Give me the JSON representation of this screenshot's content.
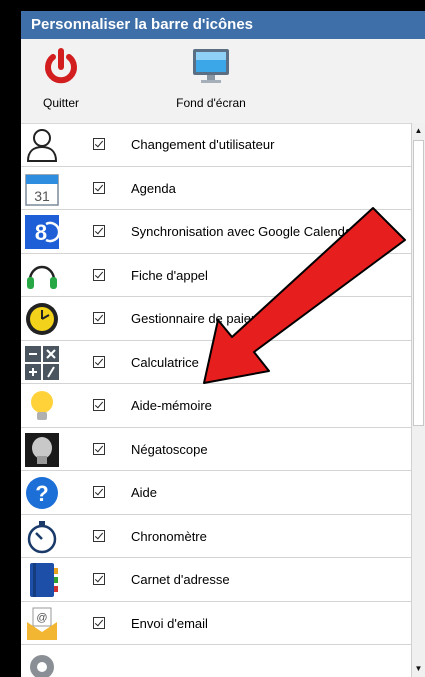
{
  "window": {
    "title": "Personnaliser la barre d'icônes"
  },
  "toolbar": {
    "quit_label": "Quitter",
    "wallpaper_label": "Fond d'écran",
    "quit_icon": "power-icon",
    "wallpaper_icon": "monitor-icon"
  },
  "items": [
    {
      "label": "Changement d'utilisateur",
      "icon": "user-icon",
      "checked": true
    },
    {
      "label": "Agenda",
      "icon": "calendar-icon",
      "checked": true
    },
    {
      "label": "Synchronisation avec Google Calendar",
      "icon": "sync-icon",
      "checked": true
    },
    {
      "label": "Fiche d'appel",
      "icon": "headset-icon",
      "checked": true
    },
    {
      "label": "Gestionnaire de paiements",
      "icon": "clock-icon",
      "checked": true
    },
    {
      "label": "Calculatrice",
      "icon": "calculator-icon",
      "checked": true
    },
    {
      "label": "Aide-mémoire",
      "icon": "lightbulb-icon",
      "checked": true
    },
    {
      "label": "Négatoscope",
      "icon": "xray-icon",
      "checked": true
    },
    {
      "label": "Aide",
      "icon": "help-icon",
      "checked": true
    },
    {
      "label": "Chronomètre",
      "icon": "stopwatch-icon",
      "checked": true
    },
    {
      "label": "Carnet d'adresse",
      "icon": "addressbook-icon",
      "checked": true
    },
    {
      "label": "Envoi d'email",
      "icon": "email-icon",
      "checked": true
    }
  ],
  "colors": {
    "title_bar": "#3e6fa8",
    "annotation_arrow": "#e61e1e"
  }
}
